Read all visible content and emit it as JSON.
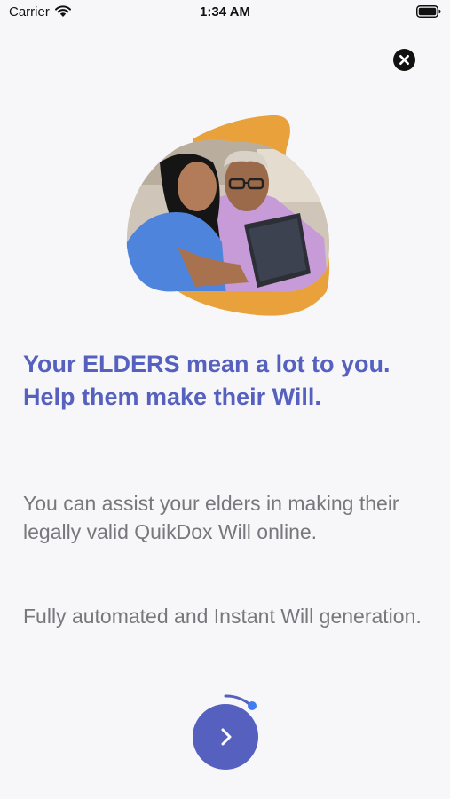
{
  "status_bar": {
    "carrier": "Carrier",
    "time": "1:34 AM",
    "wifi_icon": "wifi-icon",
    "battery_icon": "battery-icon"
  },
  "close_icon": "close-icon",
  "headline": {
    "line1": "Your ELDERS mean a lot to you.",
    "line2": "Help them make their Will."
  },
  "body": {
    "paragraph1": "You can assist your elders in making their legally valid QuikDox Will online.",
    "paragraph2": "Fully automated and Instant Will generation."
  },
  "next_icon": "chevron-right-icon",
  "progress": 0.15,
  "colors": {
    "accent": "#5560bf",
    "blob": "#e9a23b",
    "body_text": "#77777d",
    "background": "#f7f7f9"
  }
}
